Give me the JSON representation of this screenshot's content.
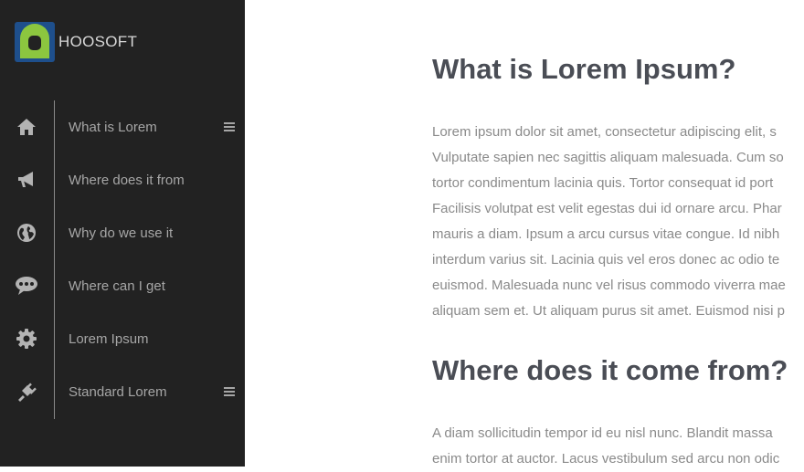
{
  "brand": {
    "name": "HOOSOFT",
    "accent": "#8cc63f",
    "logo_blue": "#1e4f8c"
  },
  "sidebar": {
    "items": [
      {
        "label": "What is Lorem",
        "icon": "home-icon",
        "has_menu": true
      },
      {
        "label": "Where does it from",
        "icon": "megaphone-icon",
        "has_menu": false
      },
      {
        "label": "Why do we use it",
        "icon": "globe-icon",
        "has_menu": false
      },
      {
        "label": "Where can I get",
        "icon": "chat-icon",
        "has_menu": false
      },
      {
        "label": "Lorem Ipsum",
        "icon": "gear-icon",
        "has_menu": false
      },
      {
        "label": "Standard Lorem",
        "icon": "plug-icon",
        "has_menu": true
      }
    ]
  },
  "main": {
    "section1": {
      "title": "What is Lorem Ipsum?",
      "lines": [
        "Lorem ipsum dolor sit amet, consectetur adipiscing elit, s",
        "Vulputate sapien nec sagittis aliquam malesuada. Cum so",
        "tortor condimentum lacinia quis. Tortor consequat id port",
        "Facilisis volutpat est velit egestas dui id ornare arcu. Phar",
        "mauris a diam. Ipsum a arcu cursus vitae congue. Id nibh",
        "interdum varius sit. Lacinia quis vel eros donec ac odio te",
        "euismod. Malesuada nunc vel risus commodo viverra mae",
        "aliquam sem et. Ut aliquam purus sit amet. Euismod nisi p"
      ]
    },
    "section2": {
      "title": "Where does it come from?",
      "lines": [
        "A diam sollicitudin tempor id eu nisl nunc. Blandit massa",
        "enim tortor at auctor. Lacus vestibulum sed arcu non odic"
      ]
    }
  }
}
